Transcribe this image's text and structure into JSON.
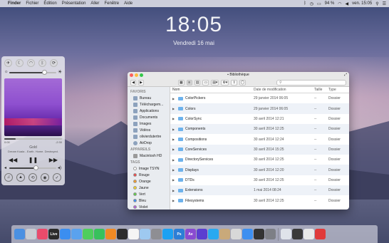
{
  "menubar": {
    "apple_icon": "apple-icon",
    "items": [
      "Finder",
      "Fichier",
      "Édition",
      "Présentation",
      "Aller",
      "Fenêtre",
      "Aide"
    ],
    "battery": "94 %",
    "clock": "ven. 15:05"
  },
  "lockscreen": {
    "time": "18:05",
    "date": "Vendredi 16 mai"
  },
  "widget": {
    "time_elapsed": "0:00",
    "time_remaining": "-2:30",
    "track": "Gold",
    "artist": "Dream Koala - Earth. Home. Destroyed."
  },
  "finder": {
    "title": "Bibliothèque",
    "search_placeholder": "",
    "sidebar": {
      "favoris_header": "FAVORIS",
      "favoris": [
        "Bureau",
        "Téléchargem...",
        "Applications",
        "Documents",
        "Images",
        "Vidéos",
        "olivierdutertre",
        "AirDrop"
      ],
      "appareils_header": "APPAREILS",
      "appareils": [
        "Macintosh HD"
      ],
      "tags_header": "TAGS",
      "tags": [
        {
          "label": "Image TSYN",
          "color": "#ffffff"
        },
        {
          "label": "Rouge",
          "color": "#ec4a4a"
        },
        {
          "label": "Orange",
          "color": "#f39a2c"
        },
        {
          "label": "Jaune",
          "color": "#f2d22c"
        },
        {
          "label": "Vert",
          "color": "#5ecb4c"
        },
        {
          "label": "Bleu",
          "color": "#3d8ff0"
        },
        {
          "label": "Violet",
          "color": "#b061d6"
        }
      ]
    },
    "columns": {
      "name": "Nom",
      "date": "Date de modification",
      "size": "Taille",
      "kind": "Type"
    },
    "rows": [
      {
        "name": "ColorPickers",
        "date": "29 janvier 2014 06:05",
        "size": "--",
        "kind": "Dossier"
      },
      {
        "name": "Colors",
        "date": "29 janvier 2014 06:05",
        "size": "--",
        "kind": "Dossier"
      },
      {
        "name": "ColorSync",
        "date": "30 avril 2014 12:21",
        "size": "--",
        "kind": "Dossier"
      },
      {
        "name": "Components",
        "date": "30 avril 2014 12:25",
        "size": "--",
        "kind": "Dossier"
      },
      {
        "name": "Compositions",
        "date": "30 avril 2014 12:24",
        "size": "--",
        "kind": "Dossier"
      },
      {
        "name": "CoreServices",
        "date": "30 avril 2014 15:25",
        "size": "--",
        "kind": "Dossier"
      },
      {
        "name": "DirectoryServices",
        "date": "30 avril 2014 12:25",
        "size": "--",
        "kind": "Dossier"
      },
      {
        "name": "Displays",
        "date": "30 avril 2014 12:20",
        "size": "--",
        "kind": "Dossier"
      },
      {
        "name": "DTDs",
        "date": "30 avril 2014 12:25",
        "size": "--",
        "kind": "Dossier"
      },
      {
        "name": "Extensions",
        "date": "1 mai 2014 08:24",
        "size": "--",
        "kind": "Dossier"
      },
      {
        "name": "Filesystems",
        "date": "30 avril 2014 12:25",
        "size": "--",
        "kind": "Dossier"
      }
    ]
  },
  "dock": {
    "apps": [
      {
        "name": "finder-icon",
        "color": "#4a90e2",
        "glyph": ""
      },
      {
        "name": "launchpad-icon",
        "color": "#c9ccd2",
        "glyph": ""
      },
      {
        "name": "itunes-icon",
        "color": "#e94b6b",
        "glyph": ""
      },
      {
        "name": "live-icon",
        "color": "#2b2b2b",
        "glyph": "Live"
      },
      {
        "name": "safari-icon",
        "color": "#3b8ef0",
        "glyph": ""
      },
      {
        "name": "mail-icon",
        "color": "#5aa2ee",
        "glyph": ""
      },
      {
        "name": "messages-icon",
        "color": "#4fce5d",
        "glyph": ""
      },
      {
        "name": "facetime-icon",
        "color": "#38c15c",
        "glyph": ""
      },
      {
        "name": "vlc-icon",
        "color": "#f08a24",
        "glyph": ""
      },
      {
        "name": "clapper-icon",
        "color": "#2d2d2d",
        "glyph": ""
      },
      {
        "name": "photos-icon",
        "color": "#f5f5f5",
        "glyph": ""
      },
      {
        "name": "preview-icon",
        "color": "#9ec9f0",
        "glyph": ""
      },
      {
        "name": "app-gray-icon",
        "color": "#8e8e93",
        "glyph": ""
      },
      {
        "name": "twitter-icon",
        "color": "#1da1f2",
        "glyph": ""
      },
      {
        "name": "photoshop-icon",
        "color": "#2c7ed6",
        "glyph": "Ps"
      },
      {
        "name": "aftereffects-icon",
        "color": "#8a4bd1",
        "glyph": "Ae"
      },
      {
        "name": "premiere-icon",
        "color": "#5b3fd0",
        "glyph": ""
      },
      {
        "name": "skype-icon",
        "color": "#29a9f0",
        "glyph": ""
      },
      {
        "name": "contacts-icon",
        "color": "#c9a97a",
        "glyph": ""
      },
      {
        "name": "notes-icon",
        "color": "#d8d8d8",
        "glyph": ""
      },
      {
        "name": "appstore-icon",
        "color": "#3d8ff0",
        "glyph": ""
      },
      {
        "name": "terminal-icon",
        "color": "#333333",
        "glyph": ""
      },
      {
        "name": "preferences-icon",
        "color": "#7d7f86",
        "glyph": ""
      }
    ],
    "right": [
      {
        "name": "downloads-stack-icon",
        "color": "#dfe3ea",
        "glyph": ""
      },
      {
        "name": "screen-stack-icon",
        "color": "#3a3a3a",
        "glyph": ""
      },
      {
        "name": "documents-stack-icon",
        "color": "#e9e9e9",
        "glyph": ""
      },
      {
        "name": "trash-icon",
        "color": "#e03a3a",
        "glyph": ""
      }
    ]
  }
}
